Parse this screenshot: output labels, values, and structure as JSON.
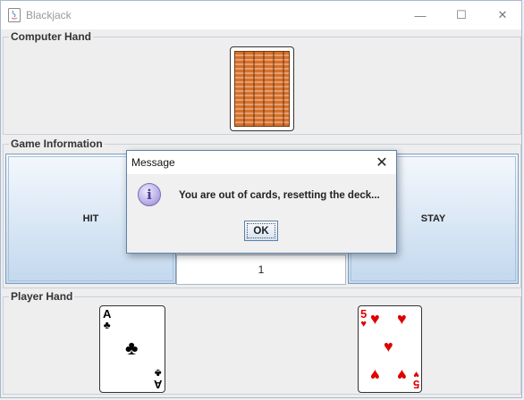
{
  "window": {
    "title": "Blackjack",
    "minimize": "—",
    "maximize": "☐",
    "close": "✕"
  },
  "computer_hand": {
    "title": "Computer Hand"
  },
  "game_info": {
    "title": "Game Information",
    "hit_label": "HIT",
    "stay_label": "STAY",
    "deck_count": "1"
  },
  "player_hand": {
    "title": "Player Hand",
    "cards": [
      {
        "rank": "A",
        "suit": "♣",
        "color": "#000000"
      },
      {
        "rank": "5",
        "suit": "♥",
        "color": "#e00000"
      }
    ]
  },
  "dialog": {
    "title": "Message",
    "message": "You are out of cards, resetting the deck...",
    "ok_label": "OK",
    "close": "✕",
    "icon_glyph": "i"
  }
}
